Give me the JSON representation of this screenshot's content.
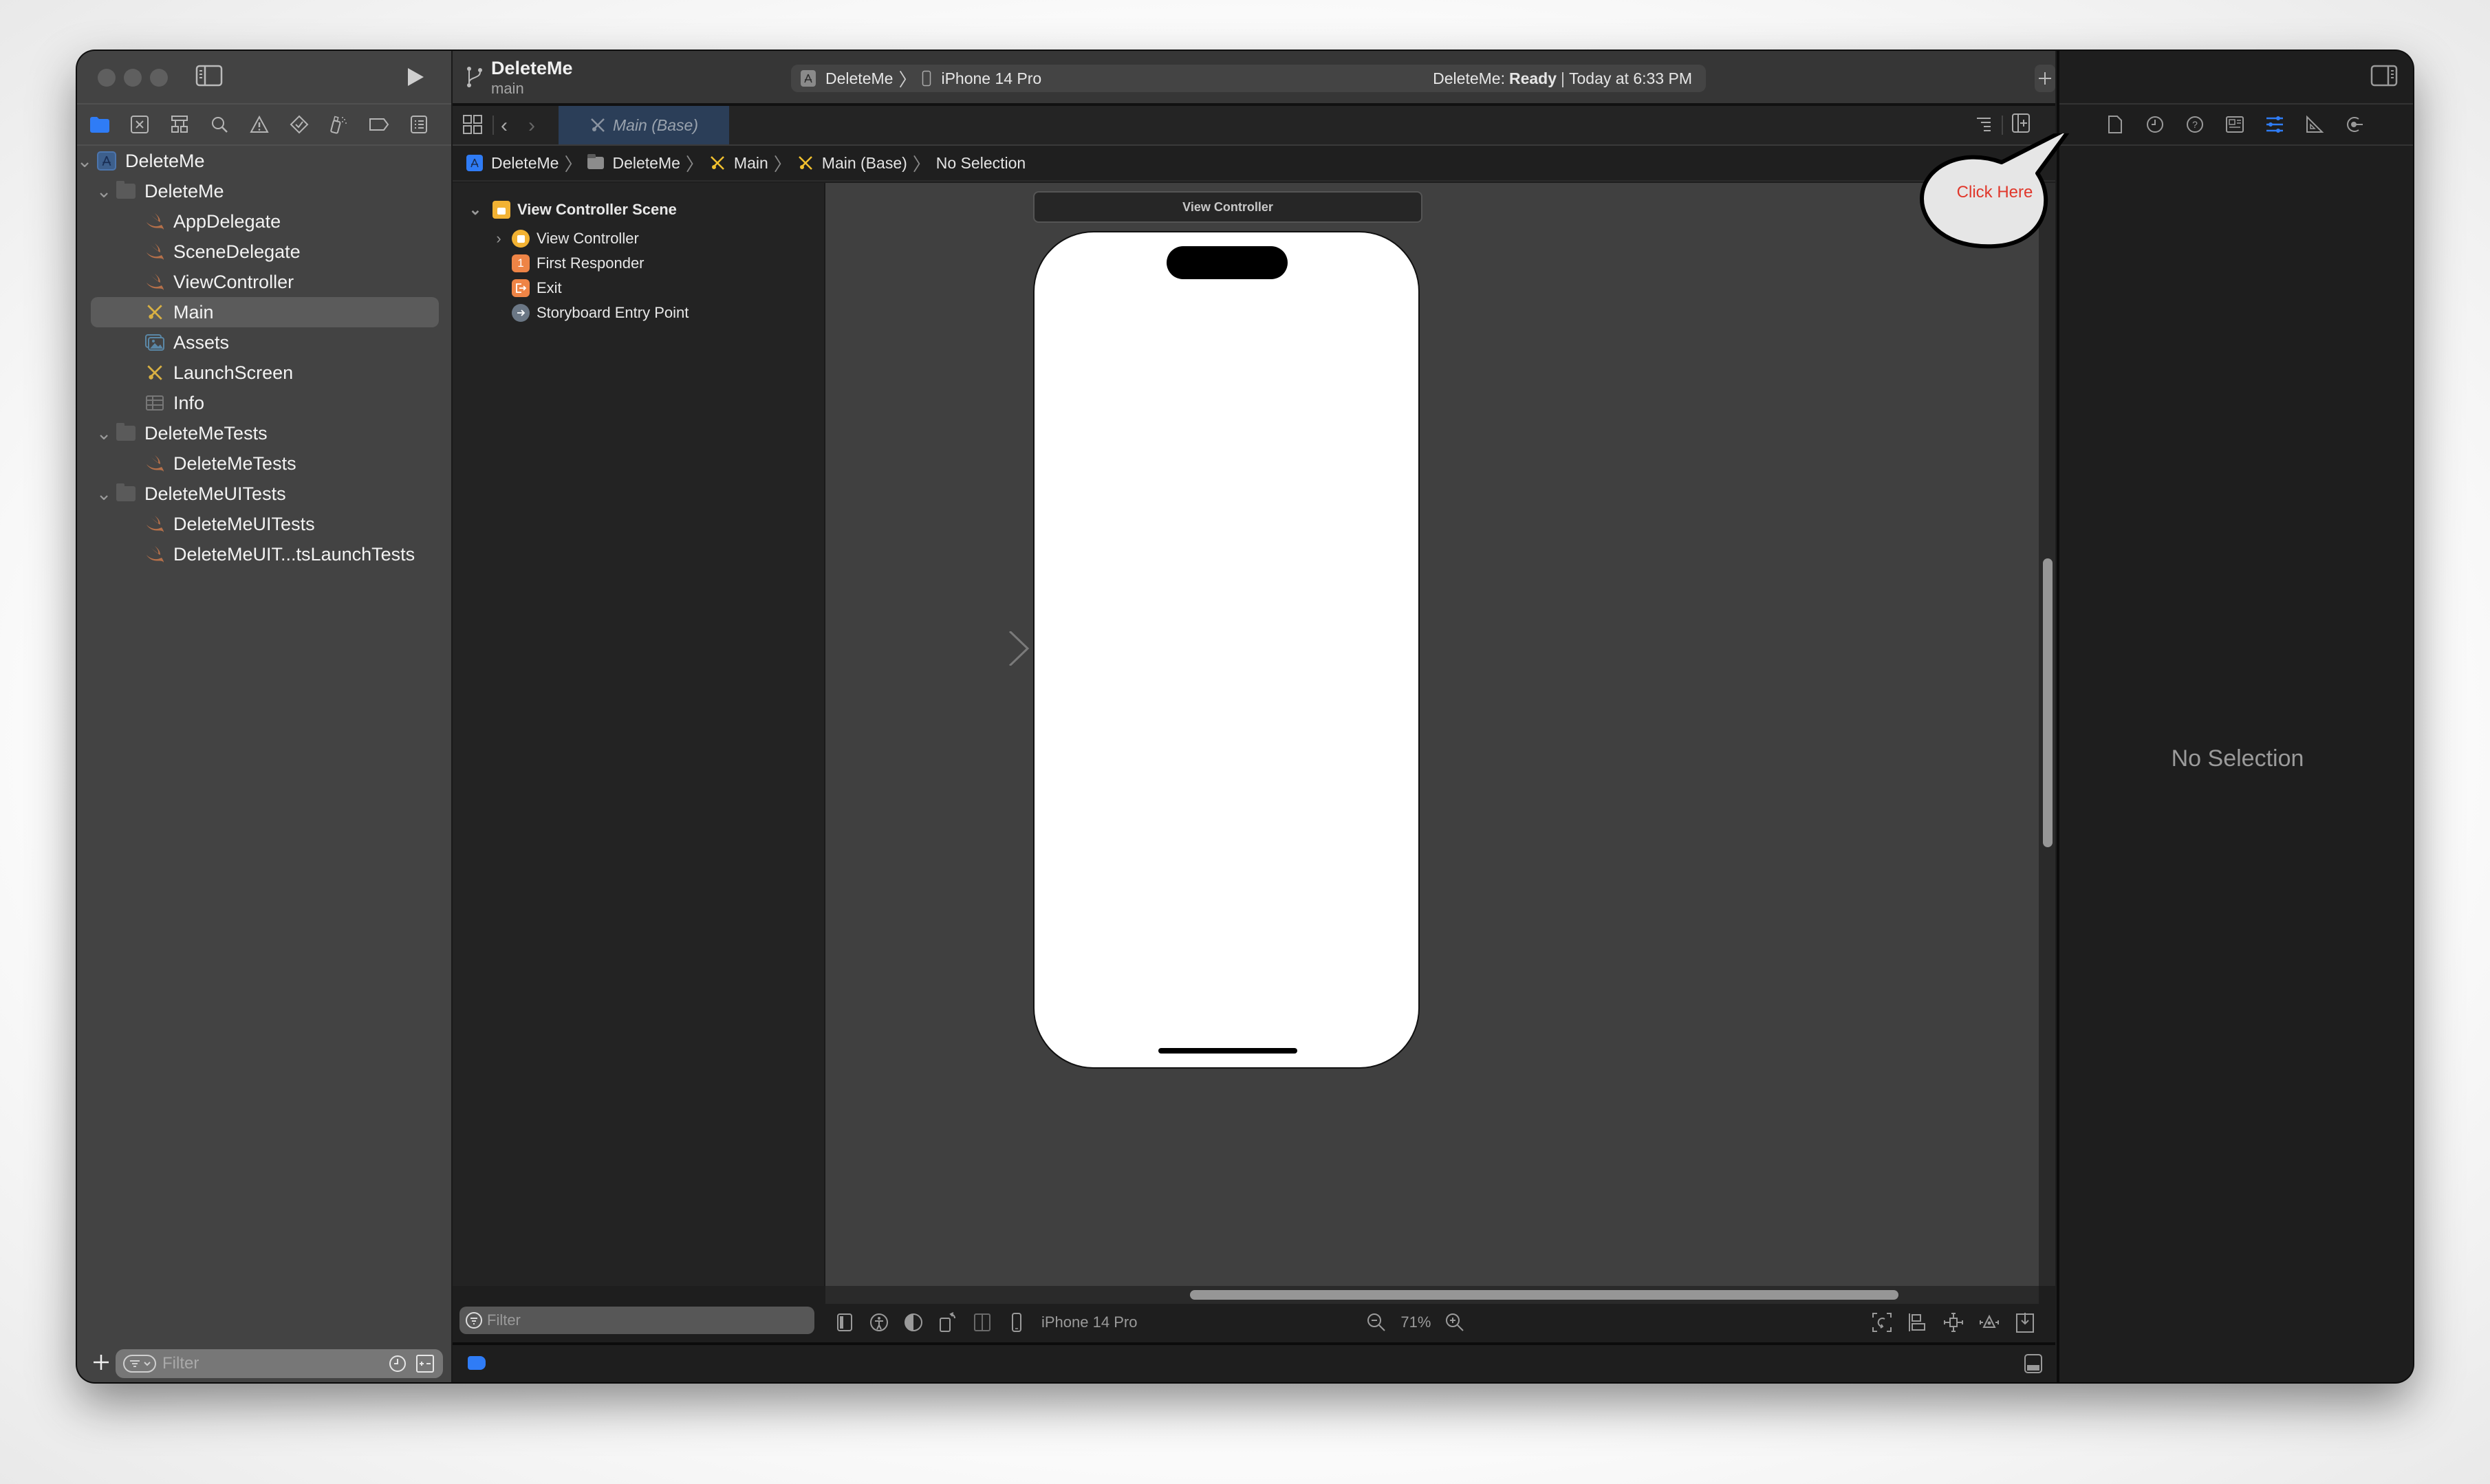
{
  "window": {
    "project_title": "DeleteMe",
    "branch": "main"
  },
  "toolbar": {
    "scheme_name": "DeleteMe",
    "device_name": "iPhone 14 Pro",
    "status_project": "DeleteMe:",
    "status_state": "Ready",
    "status_time": "Today at 6:33 PM",
    "add_button_label": "+"
  },
  "navigator": {
    "tabs": [
      "project-navigator",
      "source-control",
      "symbol",
      "find",
      "issue",
      "test",
      "debug",
      "breakpoint",
      "report"
    ],
    "tree": [
      {
        "label": "DeleteMe",
        "type": "project",
        "level": 0,
        "expanded": true
      },
      {
        "label": "DeleteMe",
        "type": "folder",
        "level": 1,
        "expanded": true
      },
      {
        "label": "AppDelegate",
        "type": "swift",
        "level": 2
      },
      {
        "label": "SceneDelegate",
        "type": "swift",
        "level": 2
      },
      {
        "label": "ViewController",
        "type": "swift",
        "level": 2
      },
      {
        "label": "Main",
        "type": "storyboard",
        "level": 2,
        "selected": true
      },
      {
        "label": "Assets",
        "type": "assets",
        "level": 2
      },
      {
        "label": "LaunchScreen",
        "type": "storyboard",
        "level": 2
      },
      {
        "label": "Info",
        "type": "plist",
        "level": 2
      },
      {
        "label": "DeleteMeTests",
        "type": "folder",
        "level": 1,
        "expanded": true
      },
      {
        "label": "DeleteMeTests",
        "type": "swift",
        "level": 2
      },
      {
        "label": "DeleteMeUITests",
        "type": "folder",
        "level": 1,
        "expanded": true
      },
      {
        "label": "DeleteMeUITests",
        "type": "swift",
        "level": 2
      },
      {
        "label": "DeleteMeUIT...tsLaunchTests",
        "type": "swift",
        "level": 2
      }
    ],
    "filter_placeholder": "Filter"
  },
  "editor": {
    "tab_label": "Main (Base)",
    "breadcrumbs": [
      "DeleteMe",
      "DeleteMe",
      "Main",
      "Main (Base)",
      "No Selection"
    ],
    "outline": {
      "scene": "View Controller Scene",
      "items": [
        {
          "label": "View Controller",
          "icon": "view-controller",
          "has_children": true
        },
        {
          "label": "First Responder",
          "icon": "first-responder",
          "glyph": "1"
        },
        {
          "label": "Exit",
          "icon": "exit"
        },
        {
          "label": "Storyboard Entry Point",
          "icon": "entry-point"
        }
      ],
      "filter_placeholder": "Filter"
    },
    "canvas": {
      "scene_title": "View Controller"
    },
    "canvas_bar": {
      "device": "iPhone 14 Pro",
      "zoom": "71%"
    }
  },
  "inspector": {
    "empty_text": "No Selection",
    "active_tab": "attributes"
  },
  "callout": {
    "text": "Click Here",
    "text_color": "#e0372b"
  },
  "colors": {
    "accent": "#2f7cf6",
    "swift": "#b5704a",
    "storyboard": "#d8b043",
    "scene_yellow": "#f2b233",
    "orange": "#ee8446"
  }
}
